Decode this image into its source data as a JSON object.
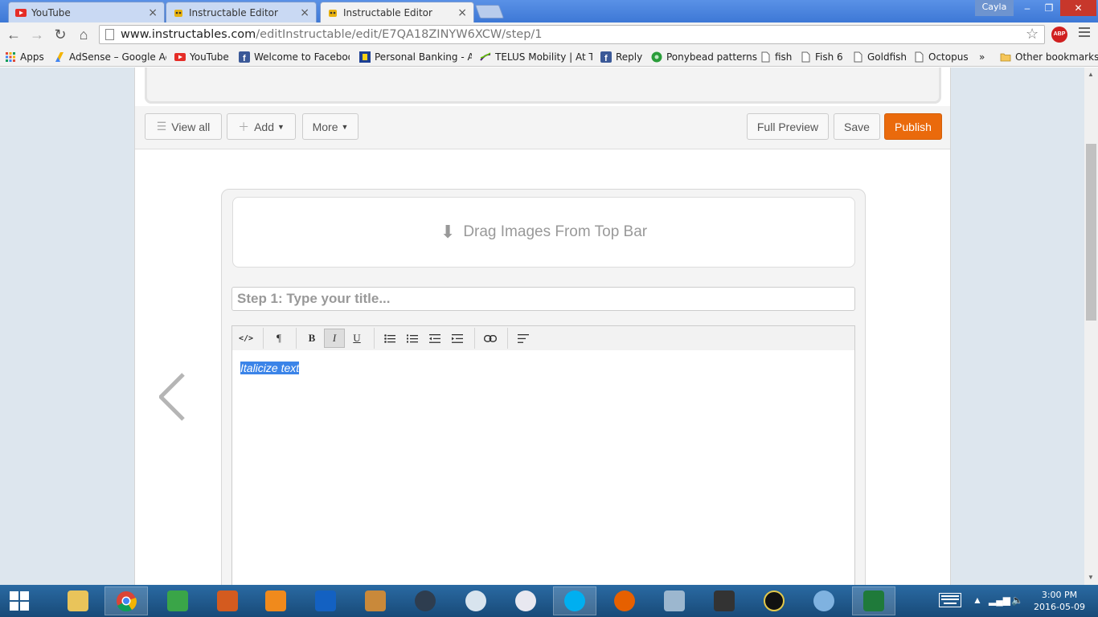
{
  "browser": {
    "tabs": [
      {
        "title": "YouTube",
        "favicon": "youtube-icon",
        "active": false
      },
      {
        "title": "Instructable Editor",
        "favicon": "instructables-robot-icon",
        "active": false
      },
      {
        "title": "Instructable Editor",
        "favicon": "instructables-robot-icon",
        "active": true
      }
    ],
    "user": "Cayla",
    "url_host": "www.instructables.com",
    "url_path": "/editInstructable/edit/E7QA18ZINYW6XCW/step/1",
    "bookmarks": [
      {
        "label": "Apps",
        "icon": "apps-grid-icon"
      },
      {
        "label": "AdSense – Google Ad",
        "icon": "adsense-icon"
      },
      {
        "label": "YouTube",
        "icon": "youtube-icon"
      },
      {
        "label": "Welcome to Faceboo",
        "icon": "facebook-icon"
      },
      {
        "label": "Personal Banking - Ac",
        "icon": "bank-icon"
      },
      {
        "label": "TELUS Mobility | At TE",
        "icon": "telus-icon"
      },
      {
        "label": "Reply",
        "icon": "facebook-icon"
      },
      {
        "label": "Ponybead patterns",
        "icon": "ponybead-icon"
      },
      {
        "label": "fish",
        "icon": "page-icon"
      },
      {
        "label": "Fish 6",
        "icon": "page-icon"
      },
      {
        "label": "Goldfish",
        "icon": "page-icon"
      },
      {
        "label": "Octopus",
        "icon": "page-icon"
      }
    ],
    "overflow_chevron": "»",
    "other_bookmarks": "Other bookmarks"
  },
  "editor": {
    "action_bar": {
      "view_all": "View all",
      "add": "Add",
      "more": "More",
      "full_preview": "Full Preview",
      "save": "Save",
      "publish": "Publish"
    },
    "dropzone_text": "Drag Images From Top Bar",
    "title_placeholder": "Step 1:  Type your title...",
    "toolbar": {
      "html": "</>",
      "paragraph": "¶",
      "bold": "B",
      "italic": "I",
      "underline": "U"
    },
    "body_text": "Italicize text"
  },
  "taskbar": {
    "time": "3:00 PM",
    "date": "2016-05-09"
  },
  "colors": {
    "publish": "#ea6a0c",
    "selection": "#3b84e8",
    "page_bg": "#dde6ee"
  }
}
